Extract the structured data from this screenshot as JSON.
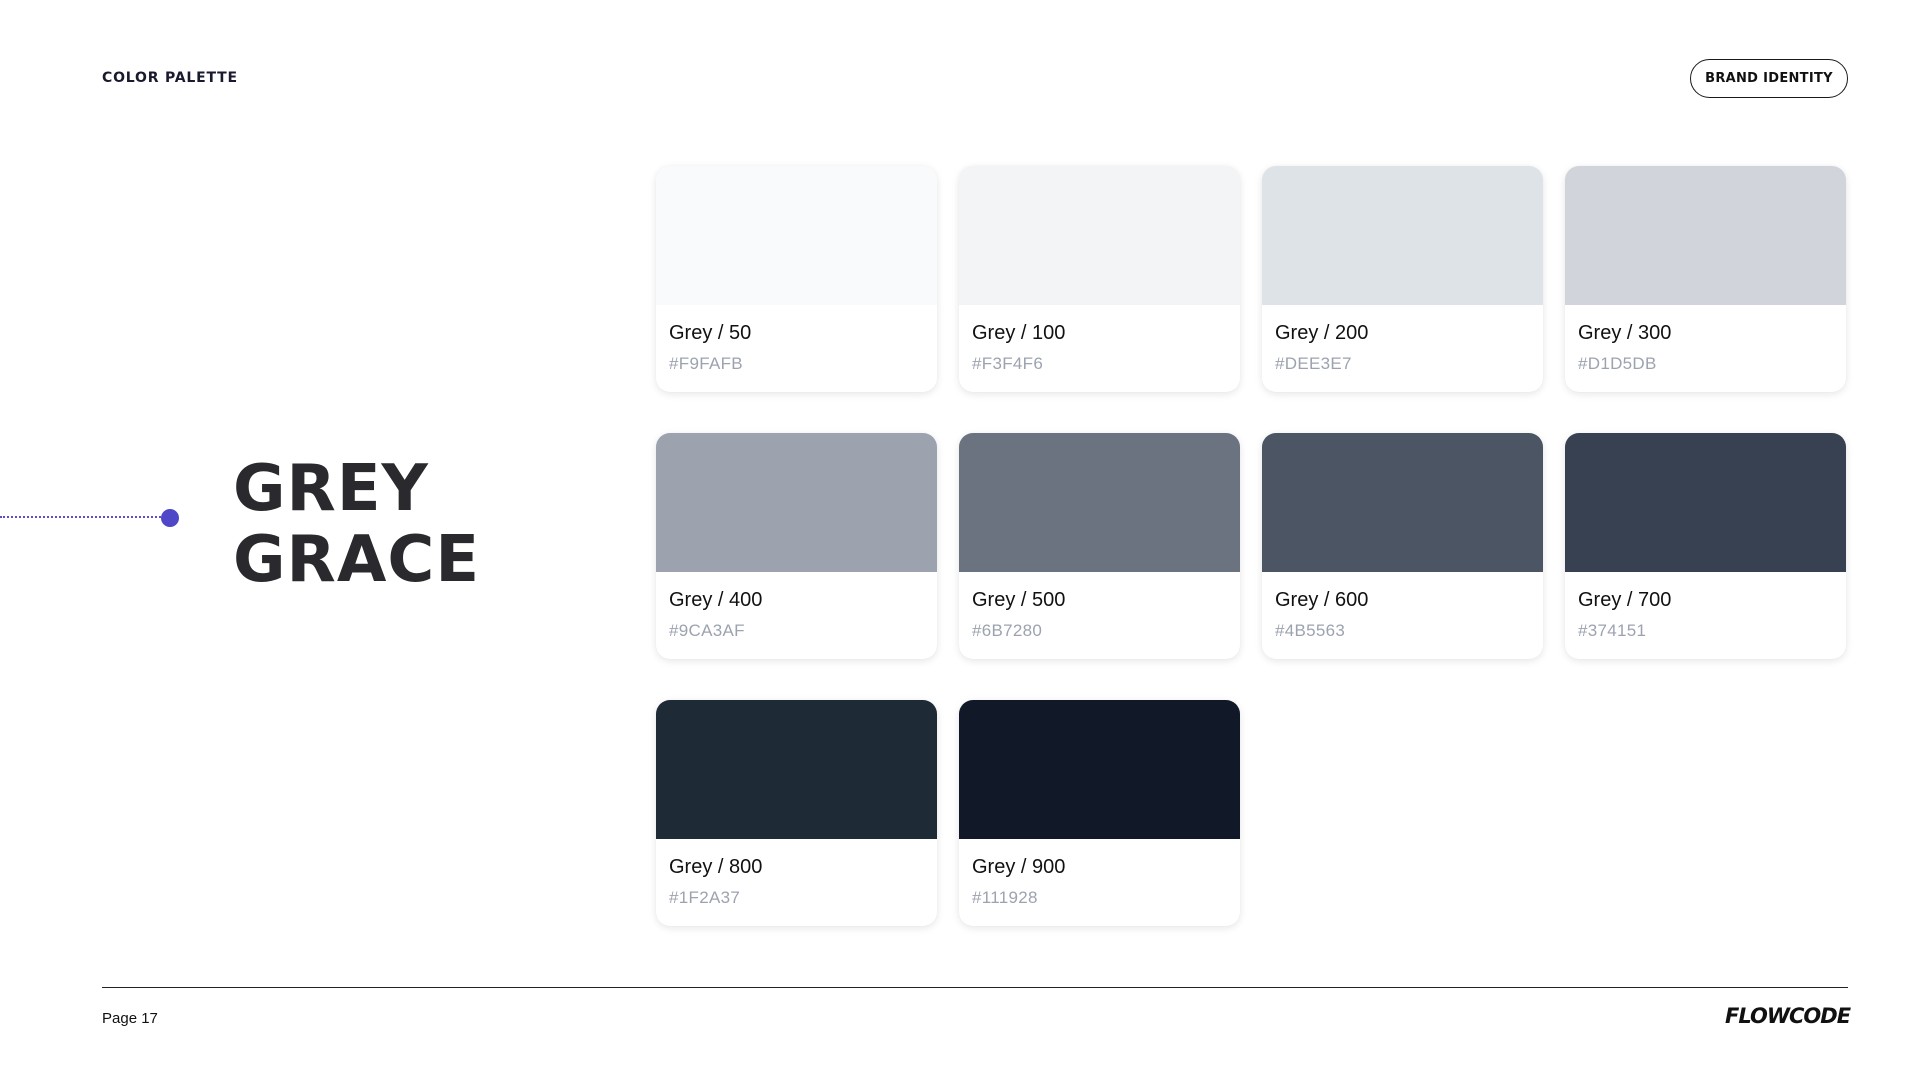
{
  "header": {
    "section_label": "COLOR PALETTE",
    "brand_pill": "BRAND IDENTITY"
  },
  "title": {
    "line1": "GREY",
    "line2": "GRACE"
  },
  "accent_color": "#4F46C8",
  "swatches": [
    {
      "name": "Grey / 50",
      "hex": "#F9FAFB"
    },
    {
      "name": "Grey / 100",
      "hex": "#F3F4F6"
    },
    {
      "name": "Grey / 200",
      "hex": "#DEE3E7"
    },
    {
      "name": "Grey / 300",
      "hex": "#D1D5DB"
    },
    {
      "name": "Grey / 400",
      "hex": "#9CA3AF"
    },
    {
      "name": "Grey / 500",
      "hex": "#6B7280"
    },
    {
      "name": "Grey / 600",
      "hex": "#4B5563"
    },
    {
      "name": "Grey / 700",
      "hex": "#374151"
    },
    {
      "name": "Grey / 800",
      "hex": "#1F2A37"
    },
    {
      "name": "Grey / 900",
      "hex": "#111928"
    }
  ],
  "footer": {
    "page": "Page 17",
    "logo": "FLOWCODE"
  }
}
